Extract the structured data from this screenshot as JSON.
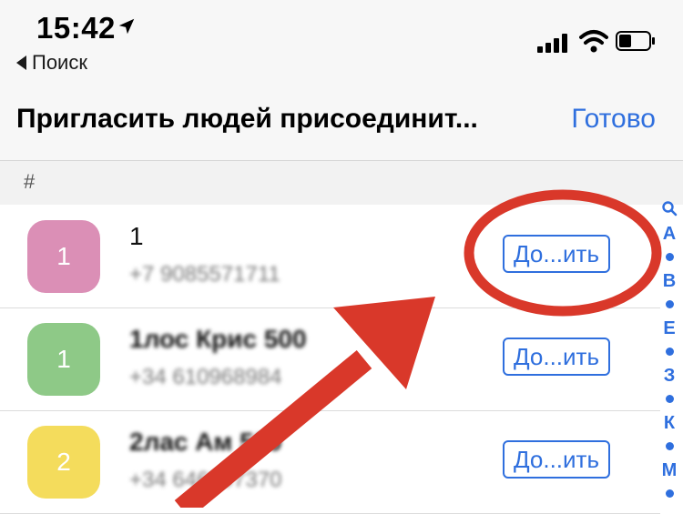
{
  "status_bar": {
    "time": "15:42",
    "back_label": "Поиск"
  },
  "navbar": {
    "title": "Пригласить людей присоединит...",
    "done_label": "Готово"
  },
  "section": {
    "header": "#"
  },
  "contacts": [
    {
      "avatar_text": "1",
      "avatar_color": "#db8fb6",
      "name": "1",
      "phone": "+7 9085571711",
      "invite_label": "До...ить"
    },
    {
      "avatar_text": "1",
      "avatar_color": "#8ec987",
      "name": "1лос Крис 500",
      "phone": "+34 610968984",
      "invite_label": "До...ить"
    },
    {
      "avatar_text": "2",
      "avatar_color": "#f4dc5c",
      "name": "2лас Ам 500",
      "phone": "+34 646897370",
      "invite_label": "До...ить"
    }
  ],
  "index_letters": [
    "А",
    "В",
    "Е",
    "З",
    "К",
    "М"
  ],
  "colors": {
    "accent": "#2f6fde",
    "annotation_red": "#d9382a"
  }
}
